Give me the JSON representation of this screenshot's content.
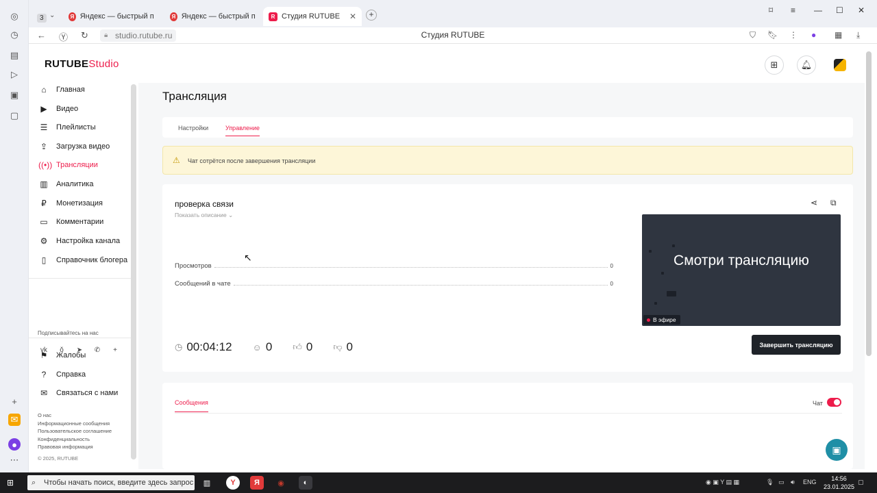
{
  "browser": {
    "tabs": [
      {
        "label": "Яндекс — быстрый поиск",
        "icon": "yandex-icon"
      },
      {
        "label": "Яндекс — быстрый поиск",
        "icon": "yandex-icon"
      },
      {
        "label": "Студия RUTUBE",
        "icon": "rutube-icon"
      }
    ],
    "tab_counter": "3",
    "url": "studio.rutube.ru",
    "page_title": "Студия RUTUBE"
  },
  "header": {
    "logo": "RUTUBE",
    "logo_suffix": "Studio"
  },
  "sidebar": {
    "items": [
      {
        "label": "Главная",
        "icon": "home-icon"
      },
      {
        "label": "Видео",
        "icon": "video-icon"
      },
      {
        "label": "Плейлисты",
        "icon": "playlist-icon"
      },
      {
        "label": "Загрузка видео",
        "icon": "upload-icon"
      },
      {
        "label": "Трансляции",
        "icon": "broadcast-icon",
        "active": true
      },
      {
        "label": "Аналитика",
        "icon": "analytics-icon"
      },
      {
        "label": "Монетизация",
        "icon": "money-icon"
      },
      {
        "label": "Комментарии",
        "icon": "comments-icon"
      },
      {
        "label": "Настройка канала",
        "icon": "settings-icon"
      },
      {
        "label": "Справочник блогера",
        "icon": "help-book-icon"
      }
    ],
    "subscribe_label": "Подписывайтесь на нас",
    "bottom_items": [
      {
        "label": "Жалобы",
        "icon": "flag-icon"
      },
      {
        "label": "Справка",
        "icon": "question-icon"
      },
      {
        "label": "Связаться с нами",
        "icon": "mail-icon"
      }
    ],
    "footer_links": [
      "О нас",
      "Информационные сообщения",
      "Пользовательское соглашение",
      "Конфиденциальность",
      "Правовая информация"
    ],
    "copyright": "© 2025, RUTUBE"
  },
  "main": {
    "title": "Трансляция",
    "tabs": [
      {
        "label": "Настройки",
        "active": false
      },
      {
        "label": "Управление",
        "active": true
      }
    ],
    "alert": "Чат сотрётся после завершения трансляции",
    "stream": {
      "title": "проверка связи",
      "show_description": "Показать описание",
      "stats": [
        {
          "label": "Просмотров",
          "value": "0"
        },
        {
          "label": "Сообщений в чате",
          "value": "0"
        }
      ],
      "preview_text": "Смотри трансляцию",
      "live_badge": "В эфире",
      "duration": "00:04:12",
      "viewers": "0",
      "likes": "0",
      "dislikes": "0",
      "end_button": "Завершить трансляцию"
    },
    "messages": {
      "tab": "Сообщения",
      "chat_label": "Чат",
      "chat_enabled": true
    }
  },
  "taskbar": {
    "search_placeholder": "Чтобы начать поиск, введите здесь запрос",
    "lang": "ENG",
    "time": "14:56",
    "date": "23.01.2025"
  },
  "colors": {
    "accent": "#ed1c4b",
    "dark_button": "#1f2329",
    "alert_bg": "#fdf6d8",
    "fab": "#1f8fa6"
  }
}
